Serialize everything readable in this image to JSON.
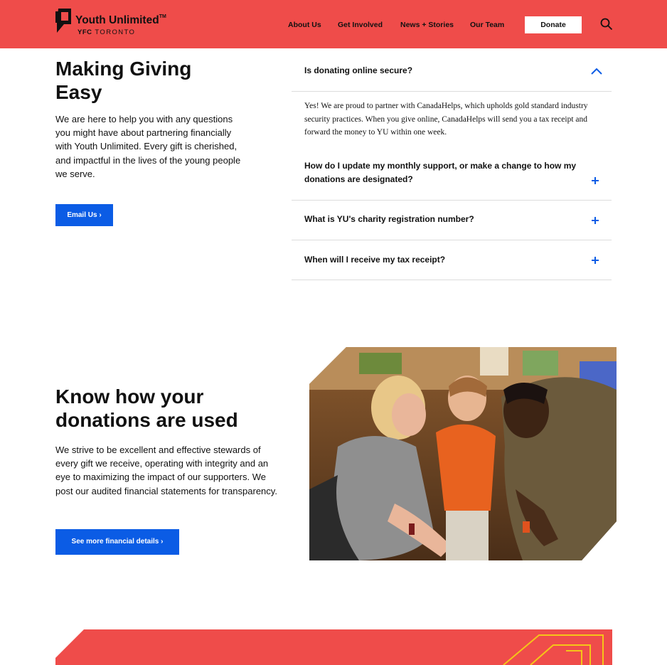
{
  "header": {
    "logo": {
      "name": "Youth Unlimited",
      "tm": "TM",
      "sub_bold": "YFC",
      "sub": "TORONTO"
    },
    "nav": [
      "About Us",
      "Get Involved",
      "News + Stories",
      "Our Team"
    ],
    "donate_label": "Donate",
    "search_icon": "search-icon"
  },
  "giving": {
    "title": "Making Giving Easy",
    "text": "We are here to help you with any questions you might have about partnering financially with Youth Unlimited. Every gift is cherished, and impactful in the lives of the young people we serve.",
    "button": "Email Us ›"
  },
  "faq": [
    {
      "question": "Is donating online secure?",
      "expanded": true,
      "answer": "Yes! We are proud to partner with CanadaHelps, which upholds gold standard industry security practices. When you give online, CanadaHelps will send you a tax receipt and forward the money to YU within one week."
    },
    {
      "question": "How do I update my monthly support, or make a change to how my donations are designated?",
      "expanded": false
    },
    {
      "question": "What is YU's charity registration number?",
      "expanded": false
    },
    {
      "question": "When will I receive my tax receipt?",
      "expanded": false
    }
  ],
  "donations": {
    "title": "Know how your donations are used",
    "text": "We strive to be excellent and effective stewards of every gift we receive, operating with integrity and an eye to maximizing the impact of our supporters. We post our audited financial statements for transparency.",
    "button": "See more financial details ›"
  },
  "colors": {
    "brand_red": "#ef4c4a",
    "accent_blue": "#0b5ce5",
    "banner_line": "#f5c518"
  }
}
